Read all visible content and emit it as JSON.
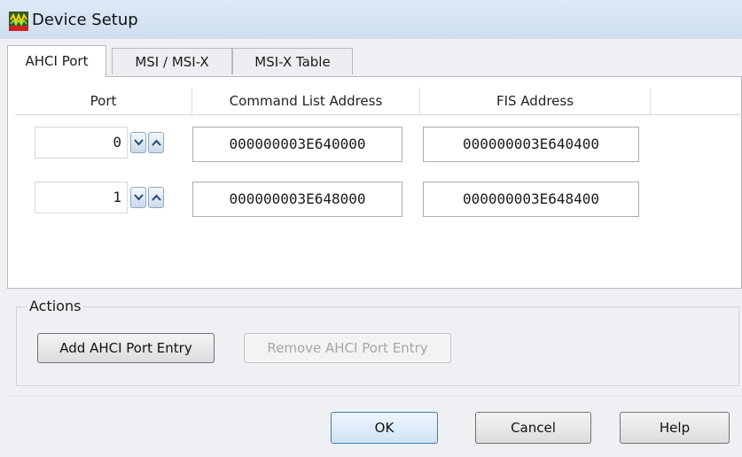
{
  "window": {
    "title": "Device Setup",
    "icon": "device-setup-icon"
  },
  "tabs": [
    {
      "label": "AHCI Port",
      "active": true
    },
    {
      "label": "MSI / MSI-X",
      "active": false
    },
    {
      "label": "MSI-X Table",
      "active": false
    }
  ],
  "table": {
    "columns": [
      "Port",
      "Command List Address",
      "FIS Address"
    ],
    "rows": [
      {
        "port": "0",
        "command_list_address": "000000003E640000",
        "fis_address": "000000003E640400"
      },
      {
        "port": "1",
        "command_list_address": "000000003E648000",
        "fis_address": "000000003E648400"
      }
    ]
  },
  "actions": {
    "label": "Actions",
    "add_label": "Add AHCI Port Entry",
    "remove_label": "Remove AHCI Port Entry"
  },
  "footer": {
    "ok_label": "OK",
    "cancel_label": "Cancel",
    "help_label": "Help"
  },
  "colors": {
    "accent": "#3c7fb1",
    "titlebar": "#d5e3f2"
  }
}
